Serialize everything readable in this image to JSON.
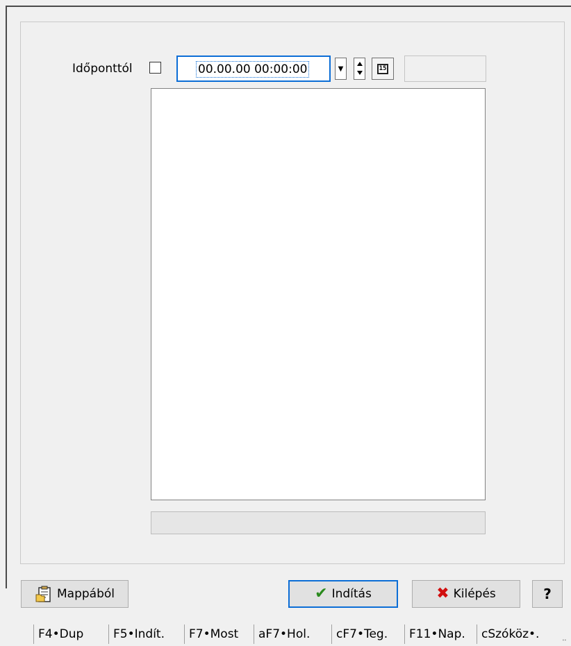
{
  "form": {
    "date_label": "Időponttól",
    "date_value": "00.00.00 00:00:00",
    "calendar_icon_text": "15"
  },
  "buttons": {
    "from_folder": "Mappából",
    "start": "Indítás",
    "exit": "Kilépés",
    "help": "?"
  },
  "icons": {
    "from_folder": "clipboard-folder-icon",
    "start": "checkmark-icon",
    "exit": "x-icon",
    "calendar": "calendar-icon",
    "dropdown": "chevron-down-icon",
    "spin": "spin-updown-icon"
  },
  "colors": {
    "focus": "#0b6dd6",
    "check": "#2a8a1d",
    "exit": "#d10f0f"
  },
  "statusbar": {
    "items": [
      "F4•Dup",
      "F5•Indít.",
      "F7•Most",
      "aF7•Hol.",
      "cF7•Teg.",
      "F11•Nap.",
      "cSzóköz•."
    ]
  }
}
